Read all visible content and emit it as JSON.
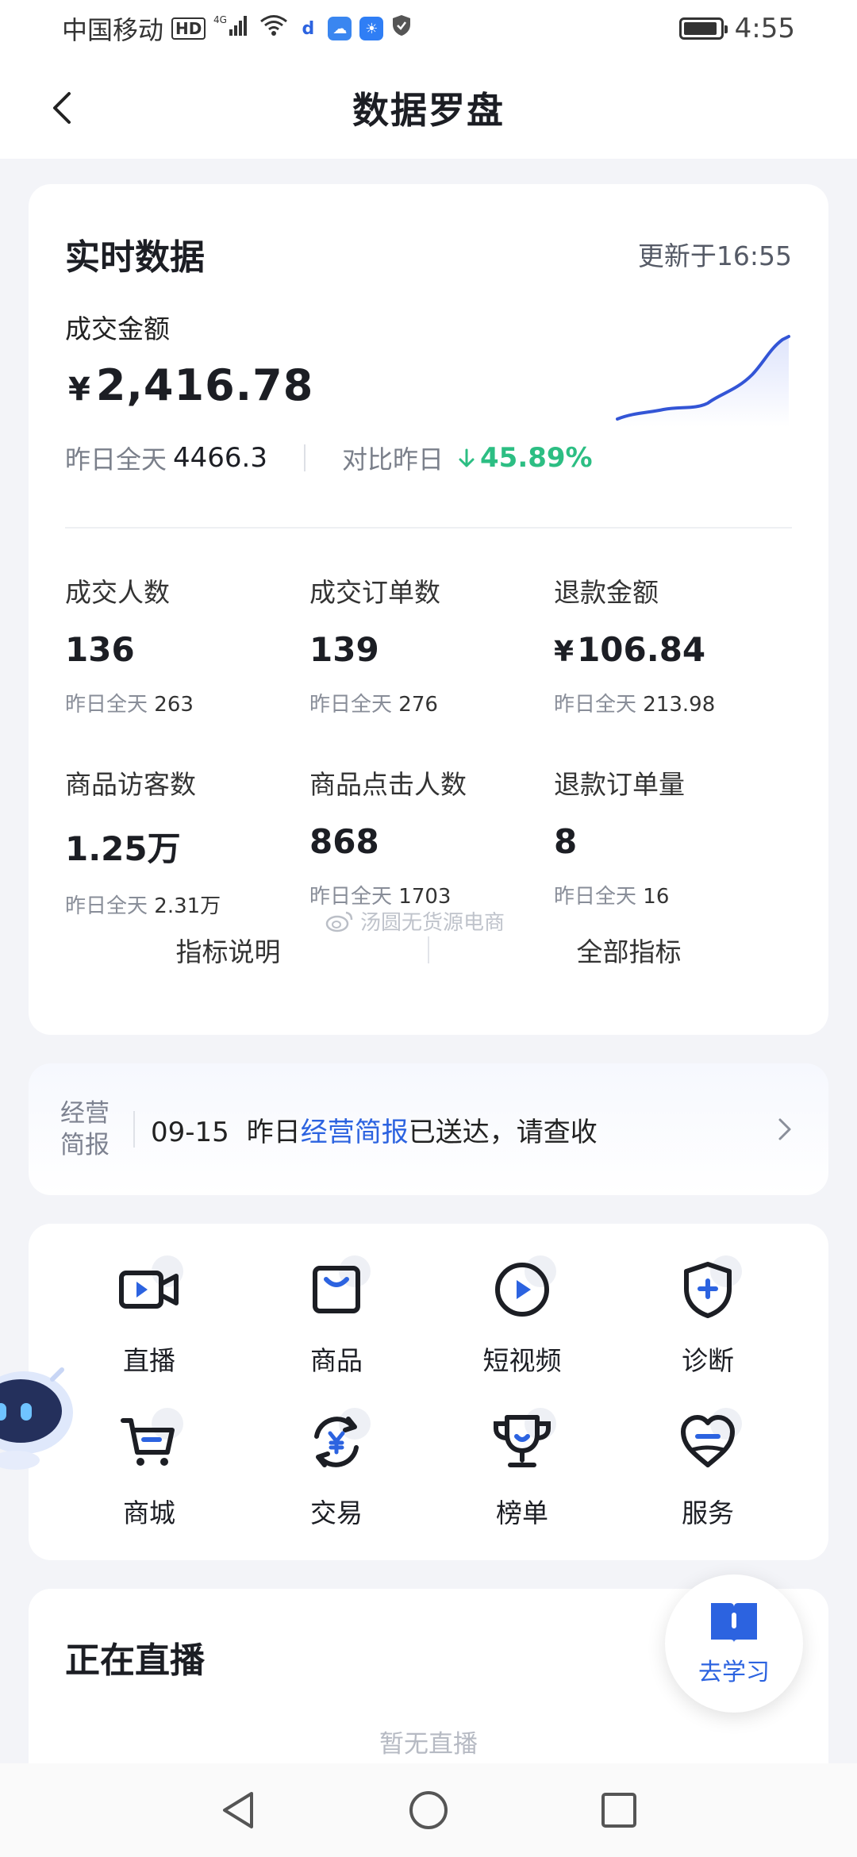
{
  "status_bar": {
    "carrier": "中国移动",
    "hd_badge": "HD",
    "network": "4G",
    "time": "4:55",
    "battery_level": 0.95
  },
  "header": {
    "title": "数据罗盘",
    "back_icon": "chevron-left-icon"
  },
  "realtime": {
    "title": "实时数据",
    "updated": "更新于16:55",
    "gmv": {
      "label": "成交金额",
      "currency": "¥",
      "value": "2,416.78",
      "yesterday_label": "昨日全天",
      "yesterday_value": "4466.3",
      "compare_label": "对比昨日",
      "change": "45.89%",
      "change_direction": "down",
      "trend_color": "#3355d6"
    },
    "metrics": [
      {
        "label": "成交人数",
        "value": "136",
        "sub_label": "昨日全天",
        "sub_value": "263"
      },
      {
        "label": "成交订单数",
        "value": "139",
        "sub_label": "昨日全天",
        "sub_value": "276"
      },
      {
        "label": "退款金额",
        "currency": "¥",
        "value": "106.84",
        "sub_label": "昨日全天",
        "sub_value": "213.98"
      },
      {
        "label": "商品访客数",
        "value": "1.25万",
        "sub_label": "昨日全天",
        "sub_value": "2.31万"
      },
      {
        "label": "商品点击人数",
        "value": "868",
        "sub_label": "昨日全天",
        "sub_value": "1703"
      },
      {
        "label": "退款订单量",
        "value": "8",
        "sub_label": "昨日全天",
        "sub_value": "16"
      }
    ],
    "footer": {
      "left_link": "指标说明",
      "right_link": "全部指标"
    }
  },
  "watermark": "汤圆无货源电商",
  "report": {
    "tag_line1": "经营",
    "tag_line2": "简报",
    "date": "09-15",
    "text_before": "昨日",
    "highlight": "经营简报",
    "text_after": "已送达，请查收"
  },
  "tools": [
    {
      "label": "直播",
      "icon": "live-camera-icon"
    },
    {
      "label": "商品",
      "icon": "product-bag-icon"
    },
    {
      "label": "短视频",
      "icon": "play-circle-icon"
    },
    {
      "label": "诊断",
      "icon": "shield-plus-icon"
    },
    {
      "label": "商城",
      "icon": "shopping-cart-icon"
    },
    {
      "label": "交易",
      "icon": "yuan-exchange-icon"
    },
    {
      "label": "榜单",
      "icon": "trophy-icon"
    },
    {
      "label": "服务",
      "icon": "heart-service-icon"
    }
  ],
  "live": {
    "title": "正在直播",
    "empty_text": "暂无直播"
  },
  "learn_button": {
    "label": "去学习",
    "icon": "book-icon"
  },
  "colors": {
    "accent_blue": "#2c63e0",
    "down_green": "#2cbe83",
    "background": "#f3f4f8"
  }
}
